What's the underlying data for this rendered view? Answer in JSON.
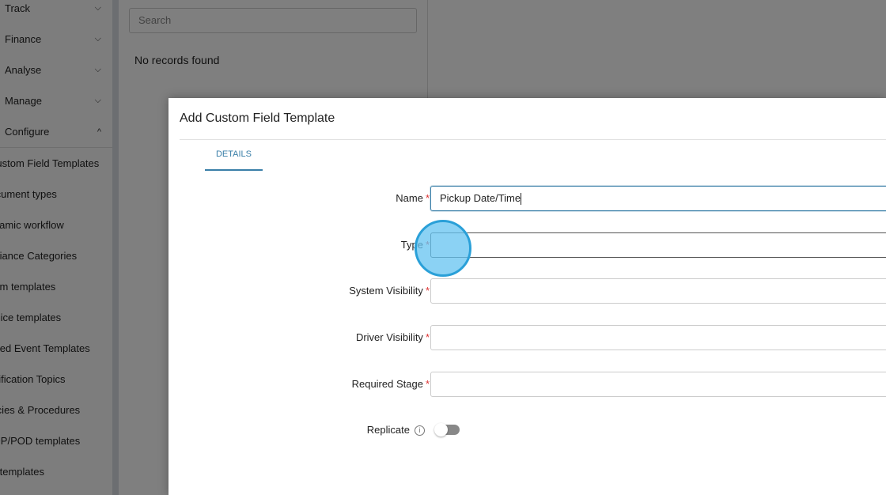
{
  "sidebar": {
    "nav": [
      {
        "label": "Track",
        "expanded": false
      },
      {
        "label": "Finance",
        "expanded": false
      },
      {
        "label": "Analyse",
        "expanded": false
      },
      {
        "label": "Manage",
        "expanded": false
      },
      {
        "label": "Configure",
        "expanded": true
      }
    ],
    "items": [
      "Custom Field Templates",
      "Document types",
      "Dynamic workflow",
      "Compliance Categories",
      "Form templates",
      "Invoice templates",
      "Managed Event Templates",
      "Notification Topics",
      "Policies & Procedures",
      "POP/POD templates",
      "Shift templates"
    ]
  },
  "list": {
    "search_placeholder": "Search",
    "empty": "No records found"
  },
  "modal": {
    "title": "Add Custom Field Template",
    "tab": "DETAILS",
    "fields": [
      {
        "label": "Name",
        "value": "Pickup Date/Time"
      },
      {
        "label": "Type",
        "value": ""
      },
      {
        "label": "System Visibility",
        "value": ""
      },
      {
        "label": "Driver Visibility",
        "value": ""
      },
      {
        "label": "Required Stage",
        "value": ""
      }
    ],
    "replicate_label": "Replicate",
    "replicate_on": false,
    "required_mark": "*",
    "info_icon": "i"
  }
}
